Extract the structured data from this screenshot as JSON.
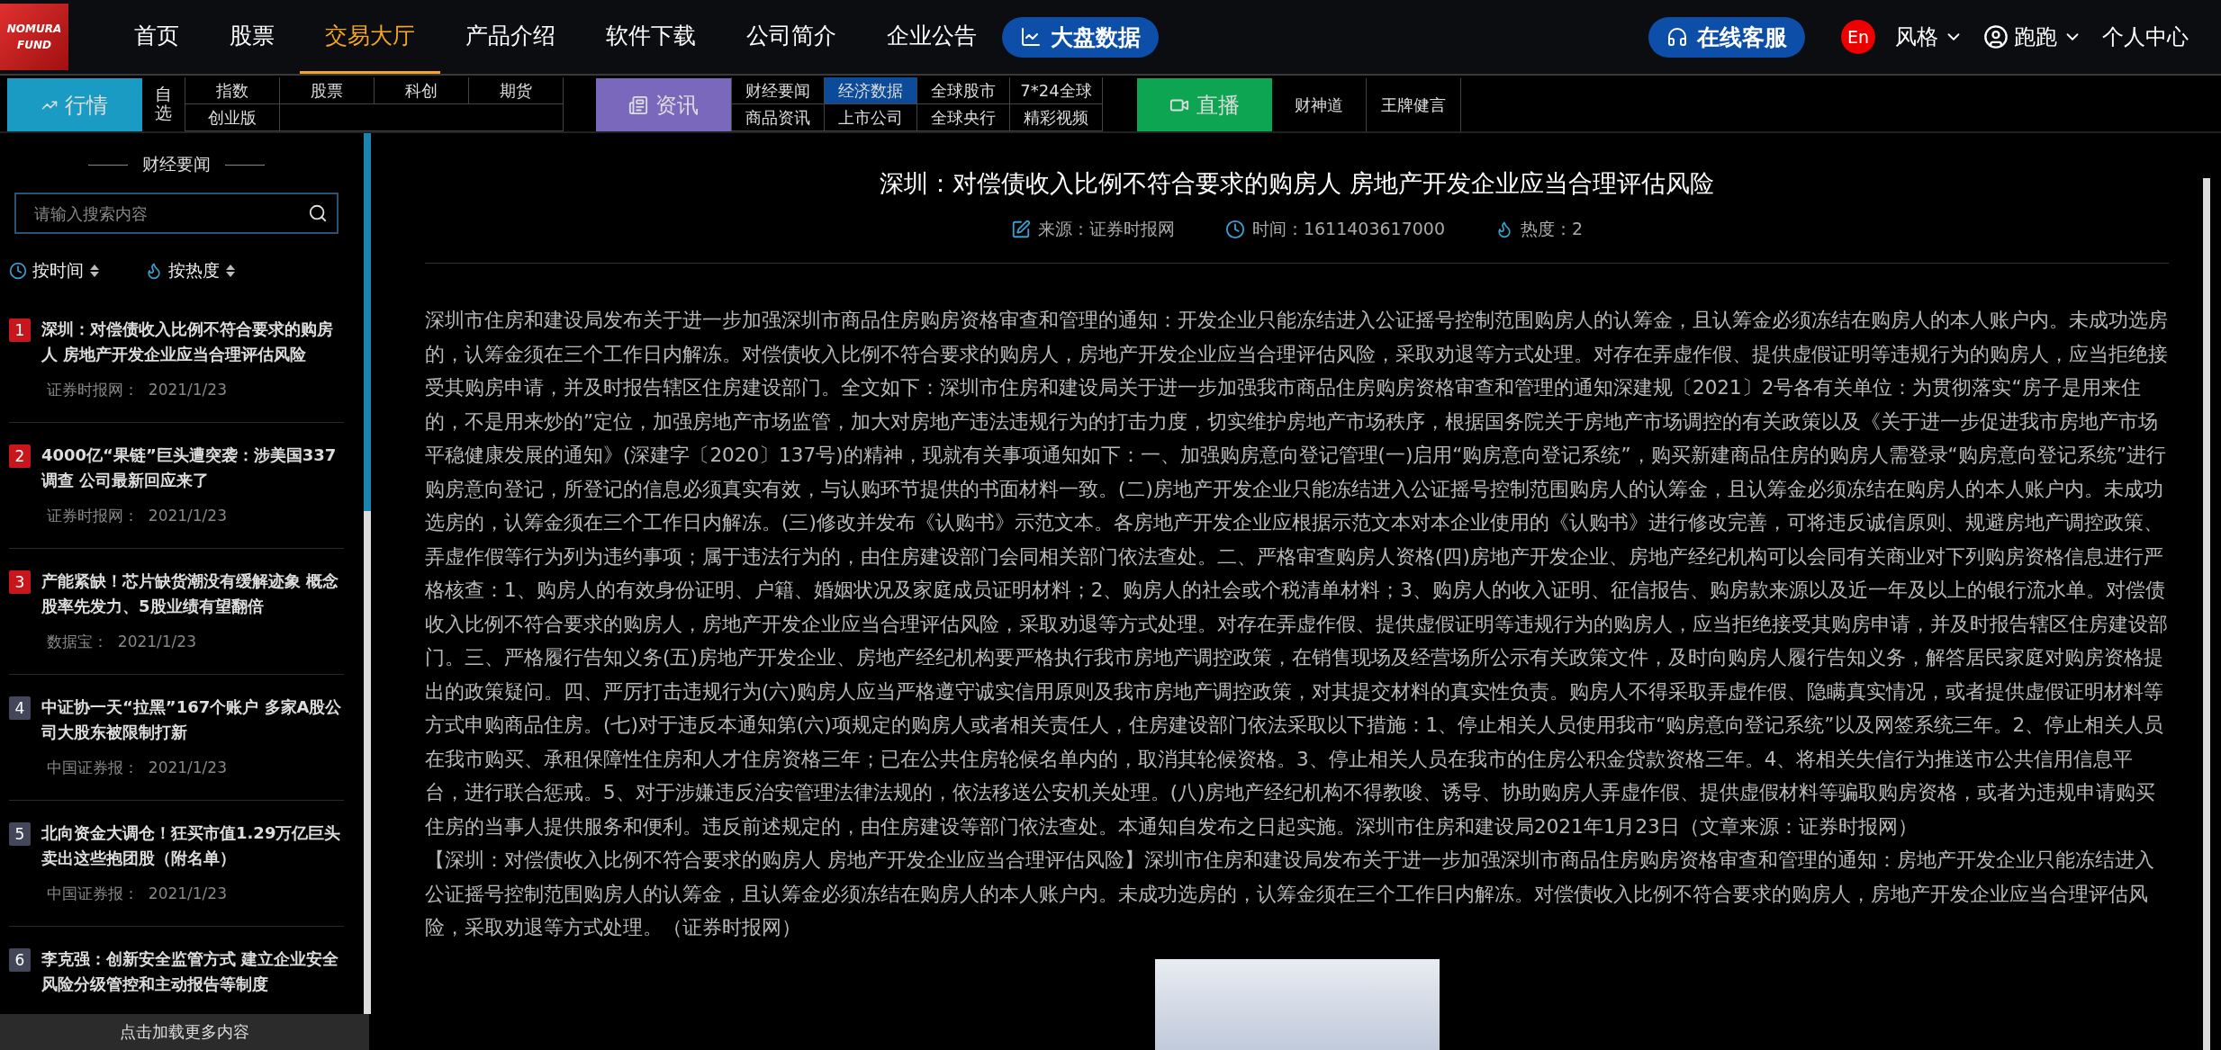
{
  "header": {
    "logo": {
      "line_1": "NOMURA",
      "line_2": "FUND"
    },
    "nav": [
      {
        "label": "首页",
        "selected": false
      },
      {
        "label": "股票",
        "selected": false
      },
      {
        "label": "交易大厅",
        "selected": true
      },
      {
        "label": "产品介绍",
        "selected": false
      },
      {
        "label": "软件下载",
        "selected": false
      },
      {
        "label": "公司简介",
        "selected": false
      },
      {
        "label": "企业公告",
        "selected": false
      }
    ],
    "data_button": "大盘数据",
    "service_button": "在线客服",
    "language_badge": "En",
    "style_menu": "风格",
    "user_menu": "跑跑",
    "personal_center": "个人中心"
  },
  "subnav": {
    "market": {
      "label": "行情",
      "watchlist": "自选",
      "rows": [
        [
          {
            "label": "指数",
            "selected": false
          },
          {
            "label": "股票",
            "selected": false
          },
          {
            "label": "科创",
            "selected": false
          },
          {
            "label": "期货",
            "selected": false
          }
        ],
        [
          {
            "label": "创业版",
            "selected": false
          }
        ]
      ]
    },
    "news": {
      "label": "资讯",
      "rows": [
        [
          {
            "label": "财经要闻",
            "selected": false
          },
          {
            "label": "经济数据",
            "selected": true
          },
          {
            "label": "全球股市",
            "selected": false
          },
          {
            "label": "7*24全球",
            "selected": false
          }
        ],
        [
          {
            "label": "商品资讯",
            "selected": false
          },
          {
            "label": "上市公司",
            "selected": false
          },
          {
            "label": "全球央行",
            "selected": false
          },
          {
            "label": "精彩视频",
            "selected": false
          }
        ]
      ]
    },
    "live": {
      "label": "直播",
      "items": [
        "财神道",
        "王牌健言"
      ]
    }
  },
  "sidebar": {
    "title": "财经要闻",
    "search": {
      "placeholder": "请输入搜索内容"
    },
    "sort": [
      "按时间",
      "按热度"
    ],
    "items": [
      {
        "rank": "1",
        "color": "#c8161d",
        "title": "深圳：对偿债收入比例不符合要求的购房人 房地产开发企业应当合理评估风险",
        "source": "证券时报网：",
        "date": "2021/1/23"
      },
      {
        "rank": "2",
        "color": "#c8161d",
        "title": "4000亿“果链”巨头遭突袭：涉美国337调查 公司最新回应来了",
        "source": "证券时报网：",
        "date": "2021/1/23"
      },
      {
        "rank": "3",
        "color": "#c8161d",
        "title": "产能紧缺！芯片缺货潮没有缓解迹象 概念股率先发力、5股业绩有望翻倍",
        "source": "数据宝：",
        "date": "2021/1/23"
      },
      {
        "rank": "4",
        "color": "#44465a",
        "title": "中证协一天“拉黑”167个账户 多家A股公司大股东被限制打新",
        "source": "中国证券报：",
        "date": "2021/1/23"
      },
      {
        "rank": "5",
        "color": "#44465a",
        "title": "北向资金大调仓！狂买市值1.29万亿巨头卖出这些抱团股（附名单）",
        "source": "中国证券报：",
        "date": "2021/1/23"
      },
      {
        "rank": "6",
        "color": "#44465a",
        "title": "李克强：创新安全监管方式 建立企业安全风险分级管控和主动报告等制度"
      }
    ],
    "load_more": "点击加载更多内容"
  },
  "article": {
    "title": "深圳：对偿债收入比例不符合要求的购房人 房地产开发企业应当合理评估风险",
    "source": "来源：证券时报网",
    "time": "时间：1611403617000",
    "heat": "热度：2",
    "paragraphs": [
      "深圳市住房和建设局发布关于进一步加强深圳市商品住房购房资格审查和管理的通知：开发企业只能冻结进入公证摇号控制范围购房人的认筹金，且认筹金必须冻结在购房人的本人账户内。未成功选房的，认筹金须在三个工作日内解冻。对偿债收入比例不符合要求的购房人，房地产开发企业应当合理评估风险，采取劝退等方式处理。对存在弄虚作假、提供虚假证明等违规行为的购房人，应当拒绝接受其购房申请，并及时报告辖区住房建设部门。全文如下：深圳市住房和建设局关于进一步加强我市商品住房购房资格审查和管理的通知深建规〔2021〕2号各有关单位：为贯彻落实“房子是用来住的，不是用来炒的”定位，加强房地产市场监管，加大对房地产违法违规行为的打击力度，切实维护房地产市场秩序，根据国务院关于房地产市场调控的有关政策以及《关于进一步促进我市房地产市场平稳健康发展的通知》(深建字〔2020〕137号)的精神，现就有关事项通知如下：一、加强购房意向登记管理(一)启用“购房意向登记系统”，购买新建商品住房的购房人需登录“购房意向登记系统”进行购房意向登记，所登记的信息必须真实有效，与认购环节提供的书面材料一致。(二)房地产开发企业只能冻结进入公证摇号控制范围购房人的认筹金，且认筹金必须冻结在购房人的本人账户内。未成功选房的，认筹金须在三个工作日内解冻。(三)修改并发布《认购书》示范文本。各房地产开发企业应根据示范文本对本企业使用的《认购书》进行修改完善，可将违反诚信原则、规避房地产调控政策、弄虚作假等行为列为违约事项；属于违法行为的，由住房建设部门会同相关部门依法查处。二、严格审查购房人资格(四)房地产开发企业、房地产经纪机构可以会同有关商业对下列购房资格信息进行严格核查：1、购房人的有效身份证明、户籍、婚姻状况及家庭成员证明材料；2、购房人的社会或个税清单材料；3、购房人的收入证明、征信报告、购房款来源以及近一年及以上的银行流水单。对偿债收入比例不符合要求的购房人，房地产开发企业应当合理评估风险，采取劝退等方式处理。对存在弄虚作假、提供虚假证明等违规行为的购房人，应当拒绝接受其购房申请，并及时报告辖区住房建设部门。三、严格履行告知义务(五)房地产开发企业、房地产经纪机构要严格执行我市房地产调控政策，在销售现场及经营场所公示有关政策文件，及时向购房人履行告知义务，解答居民家庭对购房资格提出的政策疑问。四、严厉打击违规行为(六)购房人应当严格遵守诚实信用原则及我市房地产调控政策，对其提交材料的真实性负责。购房人不得采取弄虚作假、隐瞒真实情况，或者提供虚假证明材料等方式申购商品住房。(七)对于违反本通知第(六)项规定的购房人或者相关责任人，住房建设部门依法采取以下措施：1、停止相关人员使用我市“购房意向登记系统”以及网签系统三年。2、停止相关人员在我市购买、承租保障性住房和人才住房资格三年；已在公共住房轮候名单内的，取消其轮候资格。3、停止相关人员在我市的住房公积金贷款资格三年。4、将相关失信行为推送市公共信用信息平台，进行联合惩戒。5、对于涉嫌违反治安管理法律法规的，依法移送公安机关处理。(八)房地产经纪机构不得教唆、诱导、协助购房人弄虚作假、提供虚假材料等骗取购房资格，或者为违规申请购买住房的当事人提供服务和便利。违反前述规定的，由住房建设等部门依法查处。本通知自发布之日起实施。深圳市住房和建设局2021年1月23日（文章来源：证券时报网）",
      "【深圳：对偿债收入比例不符合要求的购房人 房地产开发企业应当合理评估风险】深圳市住房和建设局发布关于进一步加强深圳市商品住房购房资格审查和管理的通知：房地产开发企业只能冻结进入公证摇号控制范围购房人的认筹金，且认筹金必须冻结在购房人的本人账户内。未成功选房的，认筹金须在三个工作日内解冻。对偿债收入比例不符合要求的购房人，房地产开发企业应当合理评估风险，采取劝退等方式处理。（证券时报网）"
    ]
  }
}
